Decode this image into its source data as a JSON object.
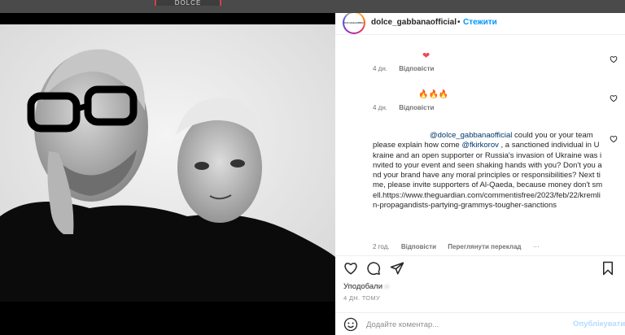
{
  "backdrop": {
    "brand_text": "DOLCE GABBANA"
  },
  "header": {
    "avatar_text": "DOLCE&GABBANA",
    "username": "dolce_gabbanaofficial",
    "separator": "•",
    "follow_label": "Стежити"
  },
  "comments": [
    {
      "text": "❤",
      "time": "4 дн.",
      "reply_label": "Відповісти"
    },
    {
      "text": "🔥🔥🔥",
      "time": "4 дн.",
      "reply_label": "Відповісти"
    },
    {
      "mention": "@dolce_gabbanaofficial",
      "text_part1": " could you or your team please explain how come ",
      "mention2": "@fkirkorov",
      "text_part2": " , a sanctioned individual in Ukraine and an open supporter or Russia's invasion of Ukraine was invited to your event and seen shaking hands with you? Don't you and your brand have any moral principles or responsibilities? Next time, please invite supporters of Al-Qaeda, because money don't smell.https://www.theguardian.com/commentisfree/2023/feb/22/kremlin-propagandists-partying-grammys-tougher-sanctions",
      "time": "2 год.",
      "reply_label": "Відповісти",
      "translate_label": "Переглянути переклад",
      "more_label": "···"
    }
  ],
  "likes": {
    "prefix": "Уподобали",
    "suffix": "и"
  },
  "timestamp": "4 ДН. ТОМУ",
  "add_comment": {
    "placeholder": "Додайте коментар...",
    "publish_label": "Опублікувати"
  },
  "colors": {
    "link": "#0095f6",
    "mention": "#00376b",
    "heart_red": "#ed4956"
  },
  "icons": [
    "heart-icon",
    "comment-icon",
    "share-icon",
    "bookmark-icon",
    "emoji-icon"
  ]
}
